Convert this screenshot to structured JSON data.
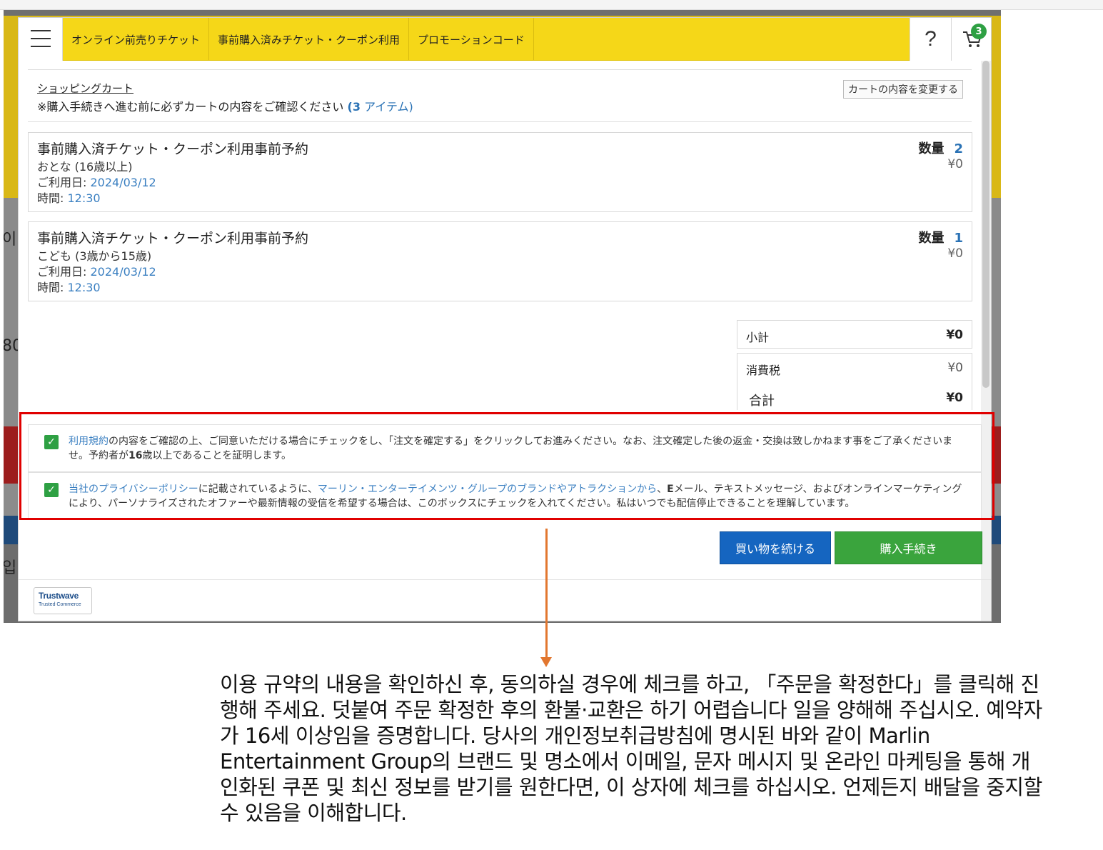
{
  "nav": {
    "tabs": [
      "オンライン前売りチケット",
      "事前購入済みチケット・クーポン利用",
      "プロモーションコード"
    ],
    "help_label": "?",
    "cart_count": "3",
    "menu_icon": "hamburger-menu-icon",
    "cart_icon": "shopping-cart-icon"
  },
  "cart": {
    "title": "ショッピングカート",
    "note": "※購入手続きへ進む前に必ずカートの内容をご確認ください",
    "count_open": "(",
    "count": "3",
    "count_label": "アイテム)",
    "edit_button": "カートの内容を変更する"
  },
  "items": [
    {
      "title": "事前購入済チケット・クーポン利用事前予約",
      "category": "おとな (16歳以上)",
      "date_label": "ご利用日:",
      "date": "2024/03/12",
      "time_label": "時間:",
      "time": "12:30",
      "qty_label": "数量",
      "qty": "2",
      "price": "¥0"
    },
    {
      "title": "事前購入済チケット・クーポン利用事前予約",
      "category": "こども (3歳から15歳)",
      "date_label": "ご利用日:",
      "date": "2024/03/12",
      "time_label": "時間:",
      "time": "12:30",
      "qty_label": "数量",
      "qty": "1",
      "price": "¥0"
    }
  ],
  "summary": {
    "subtotal_label": "小計",
    "subtotal": "¥0",
    "tax_label": "消費税",
    "tax": "¥0",
    "total_label": "合計",
    "total": "¥0"
  },
  "consent": {
    "terms_link": "利用規約",
    "terms_text_1": "の内容をご確認の上、ご同意いただける場合にチェックをし、「注文を確定する」をクリックしてお進みください。なお、注文確定した後の返金・交換は致しかねます事をご了承くださいませ。予約者が",
    "terms_bold": "16",
    "terms_text_2": "歳以上であることを証明します。",
    "privacy_link": "当社のプライバシーポリシー",
    "privacy_text_1": "に記載されているように、",
    "brand_link": "マーリン・エンターテイメンツ・グループのブランドやアトラクションから",
    "privacy_text_2": "、",
    "privacy_bold": "E",
    "privacy_text_3": "メール、テキストメッセージ、およびオンラインマーケティングにより、パーソナライズされたオファーや最新情報の受信を希望する場合は、このボックスにチェックを入れてください。私はいつでも配信停止できることを理解しています。",
    "terms_checked": true,
    "privacy_checked": true
  },
  "buttons": {
    "continue": "買い物を続ける",
    "checkout": "購入手続き"
  },
  "trustwave": {
    "title": "Trustwave",
    "subtitle": "Trusted Commerce"
  },
  "background": {
    "fragments": [
      "이",
      "80",
      "입"
    ]
  },
  "annotation": {
    "text": "이용 규약의 내용을 확인하신 후, 동의하실 경우에 체크를 하고, 「주문을 확정한다」를 클릭해 진행해 주세요. 덧붙여 주문 확정한 후의 환불·교환은 하기 어렵습니다 일을 양해해 주십시오. 예약자가 16세 이상임을 증명합니다. 당사의 개인정보취급방침에 명시된 바와 같이 Marlin Entertainment Group의 브랜드 및 명소에서 이메일, 문자 메시지 및 온라인 마케팅을 통해 개인화된 쿠폰 및 최신 정보를 받기를 원한다면, 이 상자에 체크를 하십시오. 언제든지 배달을 중지할 수 있음을 이해합니다.",
    "highlight_color": "#e00000",
    "arrow_color": "#e2772f"
  },
  "colors": {
    "nav_yellow": "#f5d718",
    "link_blue": "#3a7fc1",
    "continue_blue": "#1565c0",
    "checkout_green": "#3aa43d",
    "check_green": "#2ea043"
  }
}
